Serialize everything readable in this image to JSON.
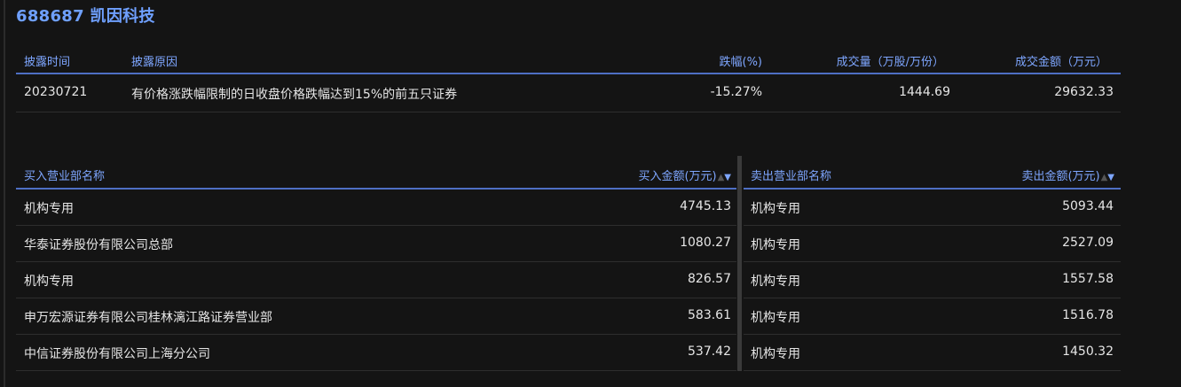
{
  "header": {
    "title": "688687 凯因科技"
  },
  "summary": {
    "columns": {
      "date": "披露时间",
      "reason": "披露原因",
      "change": "跌幅(%)",
      "volume": "成交量（万股/万份）",
      "amount": "成交金额（万元）"
    },
    "rows": [
      {
        "date": "20230721",
        "reason": "有价格涨跌幅限制的日收盘价格跌幅达到15%的前五只证券",
        "change": "-15.27%",
        "volume": "1444.69",
        "amount": "29632.33"
      }
    ]
  },
  "buy_table": {
    "columns": {
      "name": "买入营业部名称",
      "amount": "买入金额(万元)"
    },
    "rows": [
      {
        "name": "机构专用",
        "amount": "4745.13"
      },
      {
        "name": "华泰证券股份有限公司总部",
        "amount": "1080.27"
      },
      {
        "name": "机构专用",
        "amount": "826.57"
      },
      {
        "name": "申万宏源证券有限公司桂林漓江路证券营业部",
        "amount": "583.61"
      },
      {
        "name": "中信证券股份有限公司上海分公司",
        "amount": "537.42"
      }
    ]
  },
  "sell_table": {
    "columns": {
      "name": "卖出营业部名称",
      "amount": "卖出金额(万元)"
    },
    "rows": [
      {
        "name": "机构专用",
        "amount": "5093.44"
      },
      {
        "name": "机构专用",
        "amount": "2527.09"
      },
      {
        "name": "机构专用",
        "amount": "1557.58"
      },
      {
        "name": "机构专用",
        "amount": "1516.78"
      },
      {
        "name": "机构专用",
        "amount": "1450.32"
      }
    ]
  },
  "icons": {
    "sort_up": "▲",
    "sort_down": "▼"
  },
  "colors": {
    "background": "#141414",
    "accent": "#6fa0ff",
    "header_text": "#7ea6ff",
    "header_rule": "#4e6fc4",
    "row_text": "#e6e6e6"
  }
}
